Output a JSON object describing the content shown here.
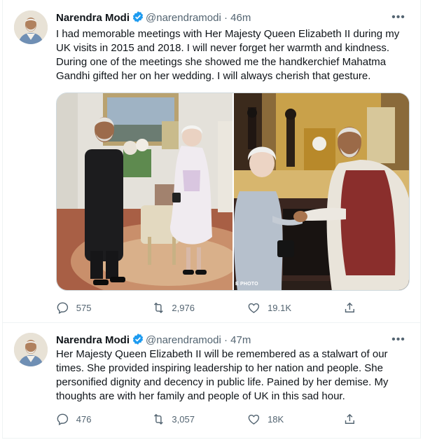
{
  "colors": {
    "verified_badge": "#1d9bf0",
    "secondary_text": "#536471",
    "primary_text": "#0f1419",
    "divider": "#eff3f4"
  },
  "tweets": [
    {
      "author_name": "Narendra Modi",
      "handle": "@narendramodi",
      "separator": "·",
      "time": "46m",
      "more_glyph": "•••",
      "text": "I had memorable meetings with Her Majesty Queen Elizabeth II during my UK visits in 2015 and 2018. I will never forget her warmth and kindness. During one of the meetings she showed me the handkerchief Mahatma Gandhi gifted her on her wedding. I will always cherish that gesture.",
      "photo_credit": "E PHOTO",
      "stats": {
        "replies": "575",
        "retweets": "2,976",
        "likes": "19.1K"
      },
      "icons": [
        "reply-icon",
        "retweet-icon",
        "like-icon",
        "share-icon"
      ]
    },
    {
      "author_name": "Narendra Modi",
      "handle": "@narendramodi",
      "separator": "·",
      "time": "47m",
      "more_glyph": "•••",
      "text": "Her Majesty Queen Elizabeth II will be remembered as a stalwart of our times. She provided inspiring leadership to her nation and people. She personified dignity and decency in public life. Pained by her demise. My thoughts are with her family and people of UK in this sad hour.",
      "stats": {
        "replies": "476",
        "retweets": "3,057",
        "likes": "18K"
      },
      "icons": [
        "reply-icon",
        "retweet-icon",
        "like-icon",
        "share-icon"
      ]
    }
  ]
}
